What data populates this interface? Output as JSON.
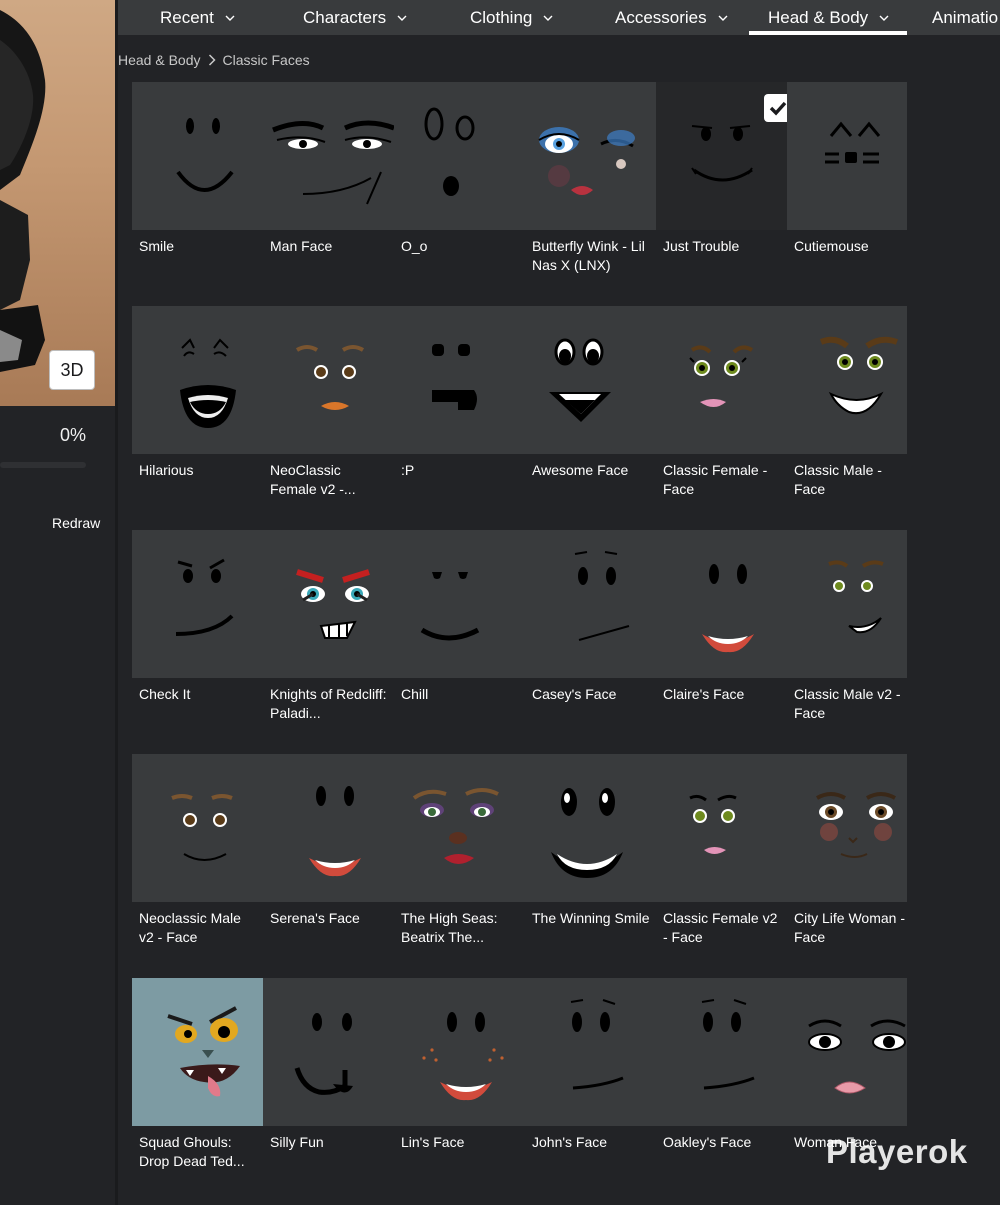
{
  "avatar_panel": {
    "view_toggle_label": "3D",
    "load_percent_text": "0%",
    "load_progress": 0,
    "redraw_label": "Redraw"
  },
  "nav": {
    "tabs": [
      {
        "label": "Recent",
        "active": false
      },
      {
        "label": "Characters",
        "active": false
      },
      {
        "label": "Clothing",
        "active": false
      },
      {
        "label": "Accessories",
        "active": false
      },
      {
        "label": "Head & Body",
        "active": true
      },
      {
        "label": "Animatio",
        "active": false
      }
    ]
  },
  "breadcrumb": {
    "parent": "Head & Body",
    "current": "Classic Faces"
  },
  "faces": [
    {
      "name": "Smile",
      "face": "smile",
      "selected": false
    },
    {
      "name": "Man Face",
      "face": "man-face",
      "selected": false
    },
    {
      "name": "O_o",
      "face": "o-o",
      "selected": false
    },
    {
      "name": "Butterfly Wink - Lil Nas X (LNX)",
      "face": "butterfly-wink",
      "selected": false
    },
    {
      "name": "Just Trouble",
      "face": "just-trouble",
      "selected": true
    },
    {
      "name": "Cutiemouse",
      "face": "cutiemouse",
      "selected": false
    },
    {
      "name": "Hilarious",
      "face": "hilarious",
      "selected": false
    },
    {
      "name": "NeoClassic Female v2 -...",
      "face": "neoclassic-female",
      "selected": false
    },
    {
      "name": ":P",
      "face": "tongue",
      "selected": false
    },
    {
      "name": "Awesome Face",
      "face": "awesome",
      "selected": false
    },
    {
      "name": "Classic Female - Face",
      "face": "classic-female",
      "selected": false
    },
    {
      "name": "Classic Male - Face",
      "face": "classic-male",
      "selected": false
    },
    {
      "name": "Check It",
      "face": "check-it",
      "selected": false
    },
    {
      "name": "Knights of Redcliff: Paladi...",
      "face": "paladin",
      "selected": false
    },
    {
      "name": "Chill",
      "face": "chill",
      "selected": false
    },
    {
      "name": "Casey's Face",
      "face": "casey",
      "selected": false
    },
    {
      "name": "Claire's Face",
      "face": "claire",
      "selected": false
    },
    {
      "name": "Classic Male v2 - Face",
      "face": "classic-male-v2",
      "selected": false
    },
    {
      "name": "Neoclassic Male v2 - Face",
      "face": "neoclassic-male",
      "selected": false
    },
    {
      "name": "Serena's Face",
      "face": "serena",
      "selected": false
    },
    {
      "name": "The High Seas: Beatrix The...",
      "face": "beatrix",
      "selected": false
    },
    {
      "name": "The Winning Smile",
      "face": "winning-smile",
      "selected": false
    },
    {
      "name": "Classic Female v2 - Face",
      "face": "classic-female-v2",
      "selected": false
    },
    {
      "name": "City Life Woman - Face",
      "face": "city-life-woman",
      "selected": false
    },
    {
      "name": "Squad Ghouls: Drop Dead Ted...",
      "face": "ghoul",
      "selected": false
    },
    {
      "name": "Silly Fun",
      "face": "silly-fun",
      "selected": false
    },
    {
      "name": "Lin's Face",
      "face": "lin",
      "selected": false
    },
    {
      "name": "John's Face",
      "face": "john",
      "selected": false
    },
    {
      "name": "Oakley's Face",
      "face": "oakley",
      "selected": false
    },
    {
      "name": "Woman Face",
      "face": "woman",
      "selected": false
    }
  ],
  "watermark": "Playerok",
  "colors": {
    "background": "#222326",
    "tile": "#393b3d",
    "selected_tile": "#262729",
    "ghoul_tile": "#7d9ba3"
  }
}
